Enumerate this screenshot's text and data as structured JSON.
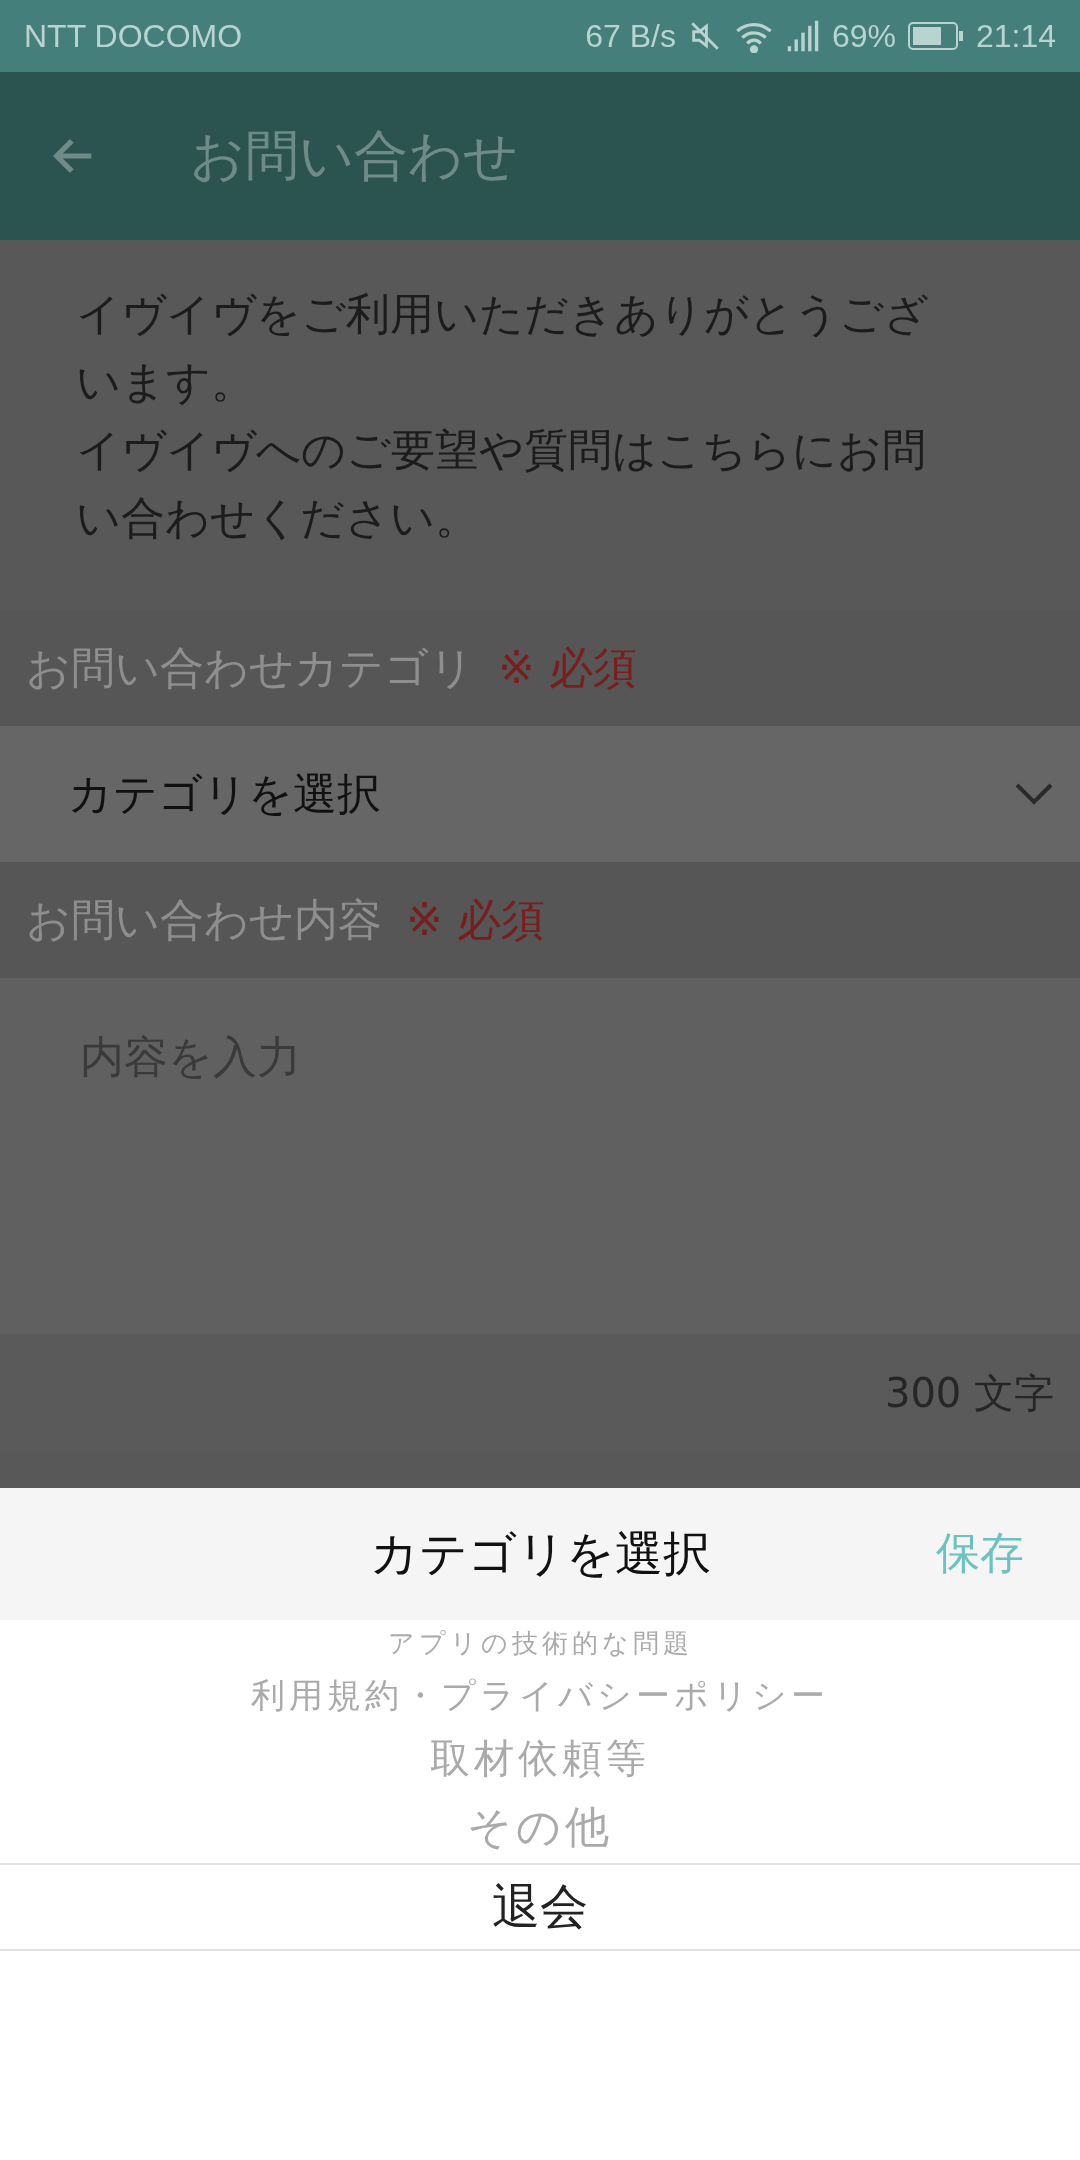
{
  "status_bar": {
    "carrier": "NTT DOCOMO",
    "speed": "67 B/s",
    "battery": "69%",
    "time": "21:14"
  },
  "app_bar": {
    "title": "お問い合わせ"
  },
  "intro": [
    "イヴイヴをご利用いただきありがとうございます。",
    "イヴイヴへのご要望や質問はこちらにお問い合わせください。"
  ],
  "category_section": {
    "label": "お問い合わせカテゴリ",
    "required": "※ 必須"
  },
  "category_select": {
    "value": "カテゴリを選択"
  },
  "content_section": {
    "label": "お問い合わせ内容",
    "required": "※ 必須"
  },
  "content_field": {
    "placeholder": "内容を入力"
  },
  "char_count": "300 文字",
  "picker": {
    "title": "カテゴリを選択",
    "save": "保存",
    "items": [
      {
        "label": "アプリの技術的な問題",
        "selected": false
      },
      {
        "label": "利用規約・プライバシーポリシー",
        "selected": false
      },
      {
        "label": "取材依頼等",
        "selected": false
      },
      {
        "label": "その他",
        "selected": false
      },
      {
        "label": "退会",
        "selected": true
      }
    ]
  }
}
